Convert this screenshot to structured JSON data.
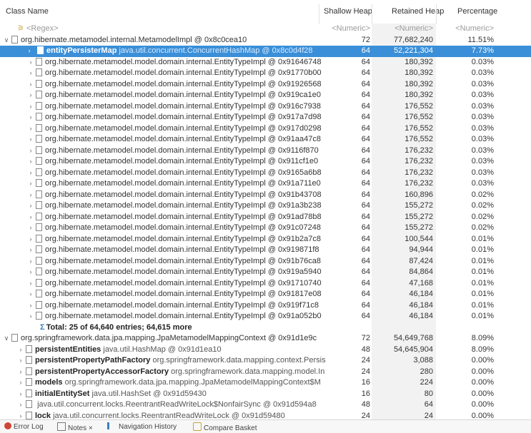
{
  "columns": {
    "class_name": "Class Name",
    "shallow_heap": "Shallow Heap",
    "retained_heap": "Retained Heap",
    "percentage": "Percentage"
  },
  "filters": {
    "regex": "<Regex>",
    "numeric": "<Numeric>"
  },
  "root": {
    "label": "org.hibernate.metamodel.internal.MetamodelImpl @ 0x8c0cea10",
    "shallow": "72",
    "retained": "77,682,240",
    "percent": "11.51%"
  },
  "selected": {
    "field": "entityPersisterMap",
    "type": "java.util.concurrent.ConcurrentHashMap @ 0x8c0d4f28",
    "shallow": "64",
    "retained": "52,221,304",
    "percent": "7.73%"
  },
  "entity_rows": [
    {
      "label": "org.hibernate.metamodel.model.domain.internal.EntityTypeImpl @ 0x91646748",
      "shallow": "64",
      "retained": "180,392",
      "percent": "0.03%"
    },
    {
      "label": "org.hibernate.metamodel.model.domain.internal.EntityTypeImpl @ 0x91770b00",
      "shallow": "64",
      "retained": "180,392",
      "percent": "0.03%"
    },
    {
      "label": "org.hibernate.metamodel.model.domain.internal.EntityTypeImpl @ 0x91926568",
      "shallow": "64",
      "retained": "180,392",
      "percent": "0.03%"
    },
    {
      "label": "org.hibernate.metamodel.model.domain.internal.EntityTypeImpl @ 0x919ca1e0",
      "shallow": "64",
      "retained": "180,392",
      "percent": "0.03%"
    },
    {
      "label": "org.hibernate.metamodel.model.domain.internal.EntityTypeImpl @ 0x916c7938",
      "shallow": "64",
      "retained": "176,552",
      "percent": "0.03%"
    },
    {
      "label": "org.hibernate.metamodel.model.domain.internal.EntityTypeImpl @ 0x917a7d98",
      "shallow": "64",
      "retained": "176,552",
      "percent": "0.03%"
    },
    {
      "label": "org.hibernate.metamodel.model.domain.internal.EntityTypeImpl @ 0x917d0298",
      "shallow": "64",
      "retained": "176,552",
      "percent": "0.03%"
    },
    {
      "label": "org.hibernate.metamodel.model.domain.internal.EntityTypeImpl @ 0x91aa47c8",
      "shallow": "64",
      "retained": "176,552",
      "percent": "0.03%"
    },
    {
      "label": "org.hibernate.metamodel.model.domain.internal.EntityTypeImpl @ 0x9116f870",
      "shallow": "64",
      "retained": "176,232",
      "percent": "0.03%"
    },
    {
      "label": "org.hibernate.metamodel.model.domain.internal.EntityTypeImpl @ 0x911cf1e0",
      "shallow": "64",
      "retained": "176,232",
      "percent": "0.03%"
    },
    {
      "label": "org.hibernate.metamodel.model.domain.internal.EntityTypeImpl @ 0x9165a6b8",
      "shallow": "64",
      "retained": "176,232",
      "percent": "0.03%"
    },
    {
      "label": "org.hibernate.metamodel.model.domain.internal.EntityTypeImpl @ 0x91a711e0",
      "shallow": "64",
      "retained": "176,232",
      "percent": "0.03%"
    },
    {
      "label": "org.hibernate.metamodel.model.domain.internal.EntityTypeImpl @ 0x91b43708",
      "shallow": "64",
      "retained": "160,896",
      "percent": "0.02%"
    },
    {
      "label": "org.hibernate.metamodel.model.domain.internal.EntityTypeImpl @ 0x91a3b238",
      "shallow": "64",
      "retained": "155,272",
      "percent": "0.02%"
    },
    {
      "label": "org.hibernate.metamodel.model.domain.internal.EntityTypeImpl @ 0x91ad78b8",
      "shallow": "64",
      "retained": "155,272",
      "percent": "0.02%"
    },
    {
      "label": "org.hibernate.metamodel.model.domain.internal.EntityTypeImpl @ 0x91c07248",
      "shallow": "64",
      "retained": "155,272",
      "percent": "0.02%"
    },
    {
      "label": "org.hibernate.metamodel.model.domain.internal.EntityTypeImpl @ 0x91b2a7c8",
      "shallow": "64",
      "retained": "100,544",
      "percent": "0.01%"
    },
    {
      "label": "org.hibernate.metamodel.model.domain.internal.EntityTypeImpl @ 0x919871f8",
      "shallow": "64",
      "retained": "94,944",
      "percent": "0.01%"
    },
    {
      "label": "org.hibernate.metamodel.model.domain.internal.EntityTypeImpl @ 0x91b76ca8",
      "shallow": "64",
      "retained": "87,424",
      "percent": "0.01%"
    },
    {
      "label": "org.hibernate.metamodel.model.domain.internal.EntityTypeImpl @ 0x919a5940",
      "shallow": "64",
      "retained": "84,864",
      "percent": "0.01%"
    },
    {
      "label": "org.hibernate.metamodel.model.domain.internal.EntityTypeImpl @ 0x91710740",
      "shallow": "64",
      "retained": "47,168",
      "percent": "0.01%"
    },
    {
      "label": "org.hibernate.metamodel.model.domain.internal.EntityTypeImpl @ 0x91817e08",
      "shallow": "64",
      "retained": "46,184",
      "percent": "0.01%"
    },
    {
      "label": "org.hibernate.metamodel.model.domain.internal.EntityTypeImpl @ 0x919f71c8",
      "shallow": "64",
      "retained": "46,184",
      "percent": "0.01%"
    },
    {
      "label": "org.hibernate.metamodel.model.domain.internal.EntityTypeImpl @ 0x91a052b0",
      "shallow": "64",
      "retained": "46,184",
      "percent": "0.01%"
    }
  ],
  "total_text": "Total: 25 of 64,640 entries; 64,615 more",
  "root2": {
    "label": "org.springframework.data.jpa.mapping.JpaMetamodelMappingContext @ 0x91d1e9c",
    "shallow": "72",
    "retained": "54,649,768",
    "percent": "8.09%"
  },
  "child_rows": [
    {
      "field": "persistentEntities",
      "type": "java.util.HashMap @ 0x91d1ea10",
      "shallow": "48",
      "retained": "54,645,904",
      "percent": "8.09%"
    },
    {
      "field": "persistentPropertyPathFactory",
      "type": "org.springframework.data.mapping.context.Persis",
      "shallow": "24",
      "retained": "3,088",
      "percent": "0.00%"
    },
    {
      "field": "persistentPropertyAccessorFactory",
      "type": "org.springframework.data.mapping.model.In",
      "shallow": "24",
      "retained": "280",
      "percent": "0.00%"
    },
    {
      "field": "models",
      "type": "org.springframework.data.jpa.mapping.JpaMetamodelMappingContext$M",
      "shallow": "16",
      "retained": "224",
      "percent": "0.00%"
    },
    {
      "field": "initialEntitySet",
      "type": "java.util.HashSet @ 0x91d59430",
      "shallow": "16",
      "retained": "80",
      "percent": "0.00%"
    },
    {
      "field": "",
      "type": "java.util.concurrent.locks.ReentrantReadWriteLock$NonfairSync @ 0x91d594a8",
      "shallow": "48",
      "retained": "64",
      "percent": "0.00%"
    },
    {
      "field": "lock",
      "type": "java.util.concurrent.locks.ReentrantReadWriteLock @ 0x91d59480",
      "shallow": "24",
      "retained": "24",
      "percent": "0.00%"
    }
  ],
  "bottom_tabs": [
    {
      "label": "Error Log"
    },
    {
      "label": "Notes"
    },
    {
      "label": "Navigation History"
    },
    {
      "label": "Compare Basket"
    }
  ],
  "colors": {
    "selection": "#3a8fd8",
    "retained_column_bg": "#f2f2f2"
  }
}
